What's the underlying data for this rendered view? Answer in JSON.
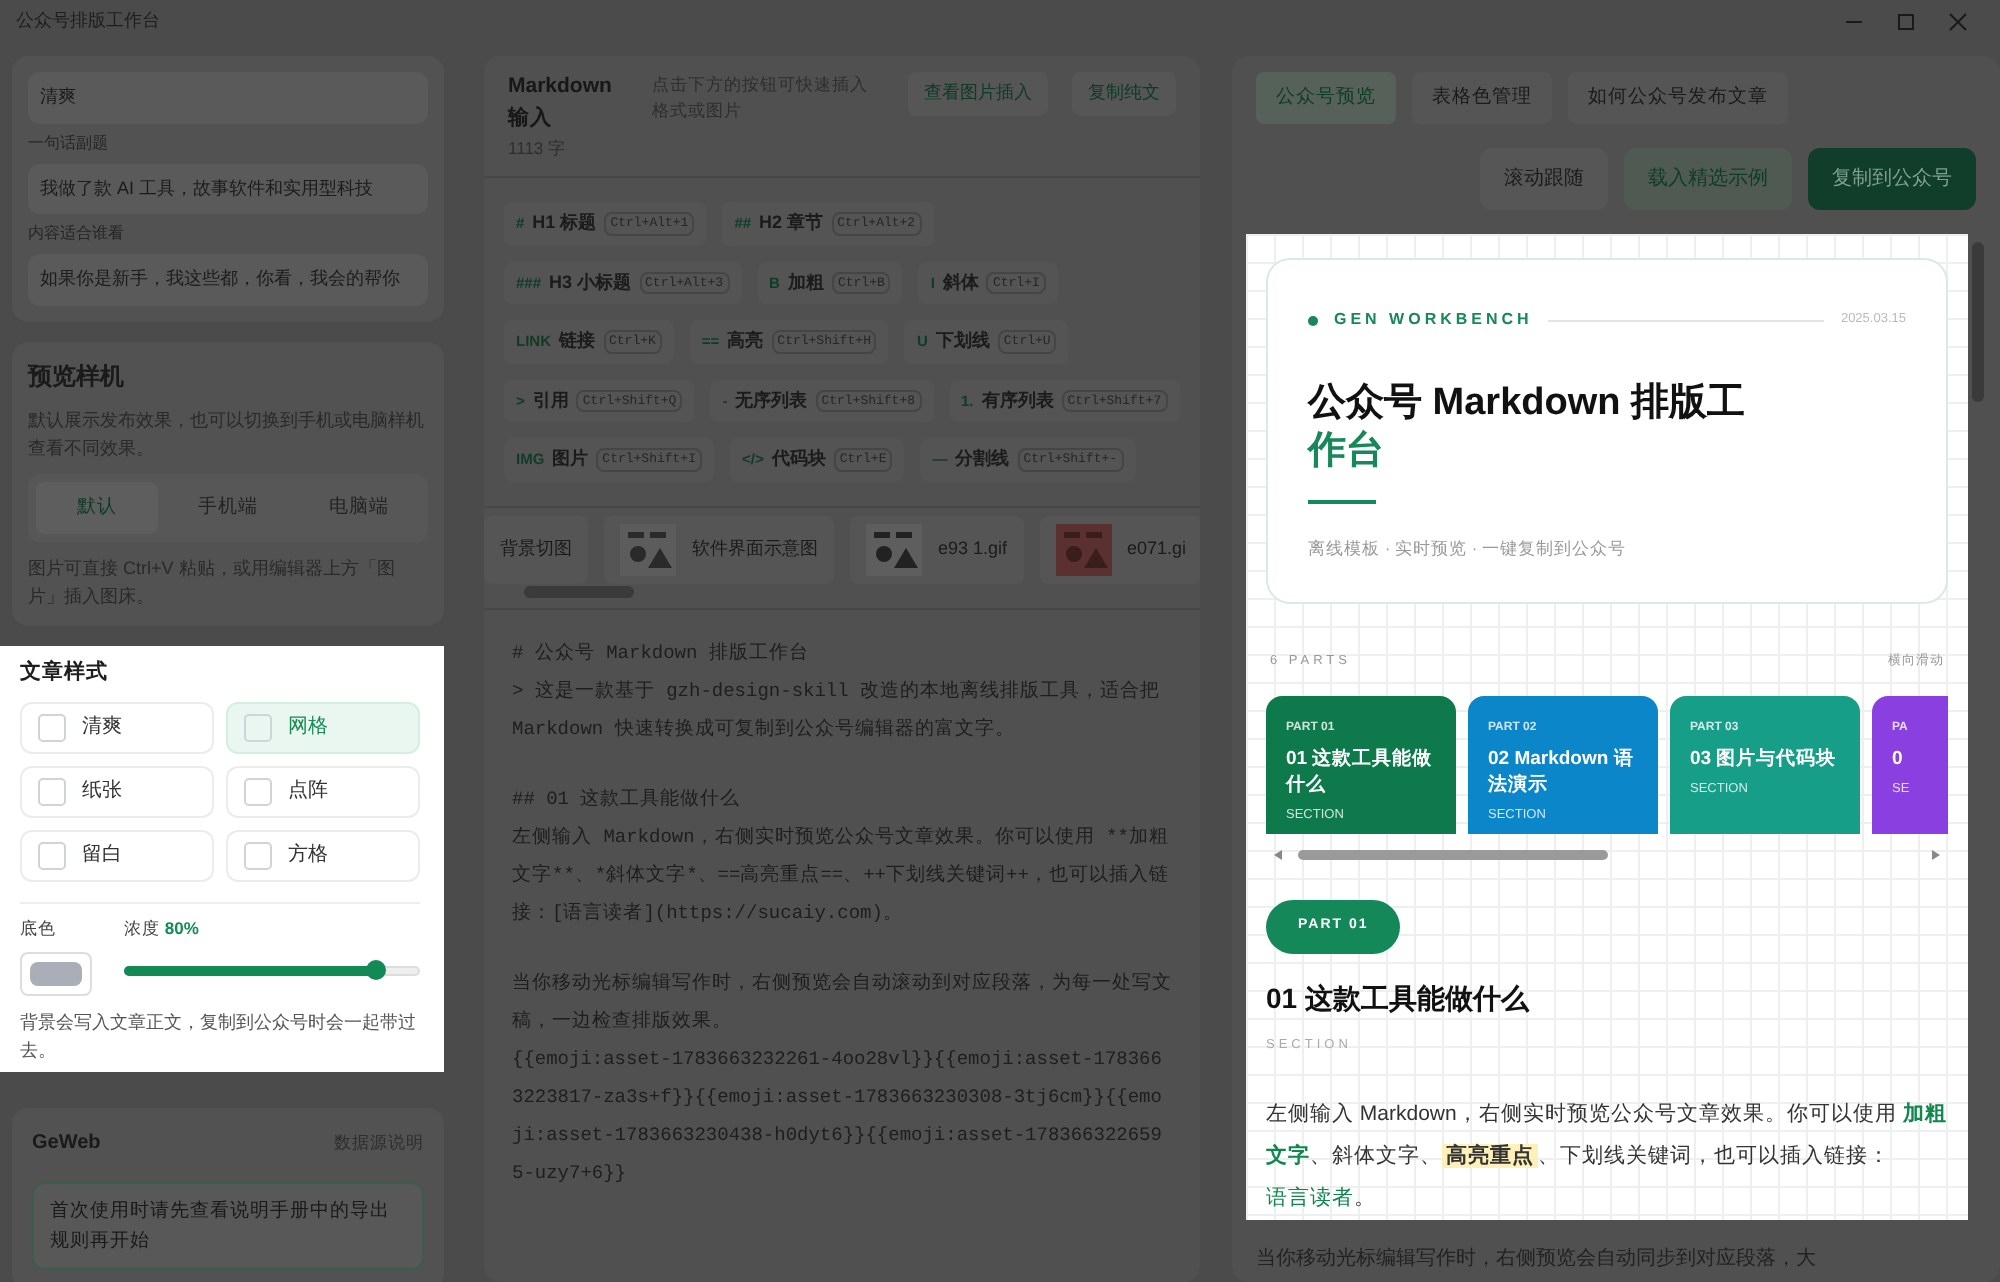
{
  "window": {
    "title": "公众号排版工作台"
  },
  "left": {
    "theme_field": {
      "value": "清爽"
    },
    "fields": [
      {
        "label": "一句话副题",
        "value": "我做了款 AI 工具，故事软件和实用型科技"
      },
      {
        "label": "内容适合谁看",
        "value": "如果你是新手，我这些都，你看，我会的帮你"
      }
    ],
    "device": {
      "title": "预览样机",
      "description": "默认展示发布效果，也可以切换到手机或电脑样机查看不同效果。",
      "options": [
        {
          "label": "默认",
          "selected": true
        },
        {
          "label": "手机端",
          "selected": false
        },
        {
          "label": "电脑端",
          "selected": false
        }
      ],
      "note": "图片可直接 Ctrl+V 粘贴，或用编辑器上方「图片」插入图床。"
    },
    "style": {
      "title": "文章样式",
      "options": [
        {
          "label": "清爽",
          "selected": false
        },
        {
          "label": "网格",
          "selected": true
        },
        {
          "label": "纸张",
          "selected": false
        },
        {
          "label": "点阵",
          "selected": false
        },
        {
          "label": "留白",
          "selected": false
        },
        {
          "label": "方格",
          "selected": false
        }
      ],
      "color_label": "底色",
      "density_label": "浓度",
      "density_value": "80%",
      "level": 0.85,
      "note": "背景会写入文章正文，复制到公众号时会一起带过去。"
    },
    "footer": {
      "title": "GeWeb",
      "link": "数据源说明",
      "notice": "首次使用时请先查看说明手册中的导出规则再开始"
    }
  },
  "editor": {
    "title": "Markdown 输入",
    "count": "1113 字",
    "hint": "点击下方的按钮可快速插入格式或图片",
    "buttons": [
      "查看图片插入",
      "复制纯文"
    ],
    "tools": [
      {
        "mark": "#",
        "label": "H1 标题",
        "shortcut": "Ctrl+Alt+1"
      },
      {
        "mark": "##",
        "label": "H2 章节",
        "shortcut": "Ctrl+Alt+2"
      },
      {
        "mark": "###",
        "label": "H3 小标题",
        "shortcut": "Ctrl+Alt+3"
      },
      {
        "mark": "B",
        "label": "加粗",
        "shortcut": "Ctrl+B"
      },
      {
        "mark": "I",
        "label": "斜体",
        "shortcut": "Ctrl+I"
      },
      {
        "mark": "LINK",
        "label": "链接",
        "shortcut": "Ctrl+K"
      },
      {
        "mark": "==",
        "label": "高亮",
        "shortcut": "Ctrl+Shift+H"
      },
      {
        "mark": "U",
        "label": "下划线",
        "shortcut": "Ctrl+U"
      },
      {
        "mark": ">",
        "label": "引用",
        "shortcut": "Ctrl+Shift+Q"
      },
      {
        "mark": "-",
        "label": "无序列表",
        "shortcut": "Ctrl+Shift+8"
      },
      {
        "mark": "1.",
        "label": "有序列表",
        "shortcut": "Ctrl+Shift+7"
      },
      {
        "mark": "IMG",
        "label": "图片",
        "shortcut": "Ctrl+Shift+I"
      },
      {
        "mark": "</>",
        "label": "代码块",
        "shortcut": "Ctrl+E"
      },
      {
        "mark": "—",
        "label": "分割线",
        "shortcut": "Ctrl+Shift+-"
      }
    ],
    "assets": [
      {
        "name": "背景切图"
      },
      {
        "name": "软件界面示意图"
      },
      {
        "name": "e93 1.gif"
      },
      {
        "name": "e071.gi"
      }
    ],
    "blocks": [
      [
        "# 公众号 Markdown 排版工作台",
        "> 这是一款基于 gzh-design-skill 改造的本地离线排版工具，适合把 Markdown 快速转换成可复制到公众号编辑器的富文字。"
      ],
      [
        "## 01 这款工具能做什么",
        "左侧输入 Markdown，右侧实时预览公众号文章效果。你可以使用 **加粗文字**、*斜体文字*、==高亮重点==、++下划线关键词++，也可以插入链接：[语言读者](https://sucaiy.com)。"
      ],
      [
        "当你移动光标编辑写作时，右侧预览会自动滚动到对应段落，为每一处写文稿，一边检查排版效果。",
        "{{emoji:asset-1783663232261-4oo28vl}}{{emoji:asset-1783663223817-za3s+f}}{{emoji:asset-1783663230308-3tj6cm}}{{emoji:asset-1783663230438-h0dyt6}}{{emoji:asset-1783663226595-uzy7+6}}"
      ]
    ]
  },
  "preview": {
    "tabs": [
      {
        "label": "公众号预览",
        "selected": true
      },
      {
        "label": "表格色管理",
        "selected": false
      },
      {
        "label": "如何公众号发布文章",
        "selected": false
      }
    ],
    "buttons": [
      {
        "label": "滚动跟随",
        "kind": "plain"
      },
      {
        "label": "载入精选示例",
        "kind": "soft"
      },
      {
        "label": "复制到公众号",
        "kind": "primary"
      }
    ],
    "cover": {
      "brand": "GEN WORKBENCH",
      "date": "2025.03.15",
      "title": "公众号 Markdown 排版工",
      "title_accent": "作台",
      "subtitle": "离线模板 · 实时预览 · 一键复制到公众号"
    },
    "parts_label": "6 PARTS",
    "parts_hint": "横向滑动",
    "parts": [
      {
        "tag": "PART 01",
        "title": "01 这款工具能做什么",
        "sub": "SECTION",
        "color": "#0e7a4c"
      },
      {
        "tag": "PART 02",
        "title": "02 Markdown 语法演示",
        "sub": "SECTION",
        "color": "#0a86c9"
      },
      {
        "tag": "PART 03",
        "title": "03 图片与代码块",
        "sub": "SECTION",
        "color": "#169e88"
      },
      {
        "tag": "PA",
        "title": "0",
        "sub": "SE",
        "color": "#8a3fe0"
      }
    ],
    "section": {
      "pill": "PART 01",
      "title": "01 这款工具能做什么",
      "sub": "SECTION",
      "paragraph": [
        {
          "kind": "text",
          "text": "左侧输入 Markdown，右侧实时预览公众号文章效果。你可以使用 "
        },
        {
          "kind": "bold",
          "text": "加粗文字"
        },
        {
          "kind": "text",
          "text": "、斜体文字、"
        },
        {
          "kind": "highlight",
          "text": "高亮重点"
        },
        {
          "kind": "text",
          "text": "、下划线关键词，也可以插入链接："
        },
        {
          "kind": "link",
          "text": "语言读者"
        },
        {
          "kind": "text",
          "text": "。"
        }
      ]
    },
    "below": "当你移动光标编辑写作时，右侧预览会自动同步到对应段落，大"
  }
}
